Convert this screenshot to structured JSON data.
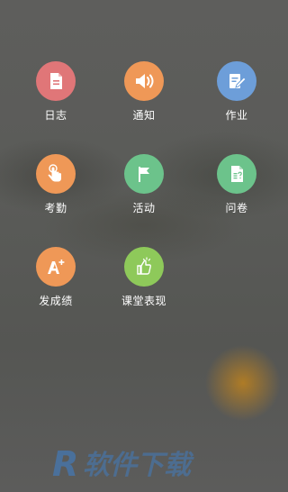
{
  "menu": {
    "items": [
      {
        "label": "日志",
        "icon": "document-icon",
        "color": "#e07678"
      },
      {
        "label": "通知",
        "icon": "speaker-icon",
        "color": "#ef9857"
      },
      {
        "label": "作业",
        "icon": "edit-document-icon",
        "color": "#6d9ed9"
      },
      {
        "label": "考勤",
        "icon": "hand-pointer-icon",
        "color": "#ef9857"
      },
      {
        "label": "活动",
        "icon": "flag-icon",
        "color": "#6cc38b"
      },
      {
        "label": "问卷",
        "icon": "survey-icon",
        "color": "#6cc38b"
      },
      {
        "label": "发成绩",
        "icon": "grade-a-plus-icon",
        "color": "#ef9857"
      },
      {
        "label": "课堂表现",
        "icon": "thumbs-up-icon",
        "color": "#8ec95a"
      }
    ]
  },
  "watermark": {
    "text": "R 软件下载"
  }
}
